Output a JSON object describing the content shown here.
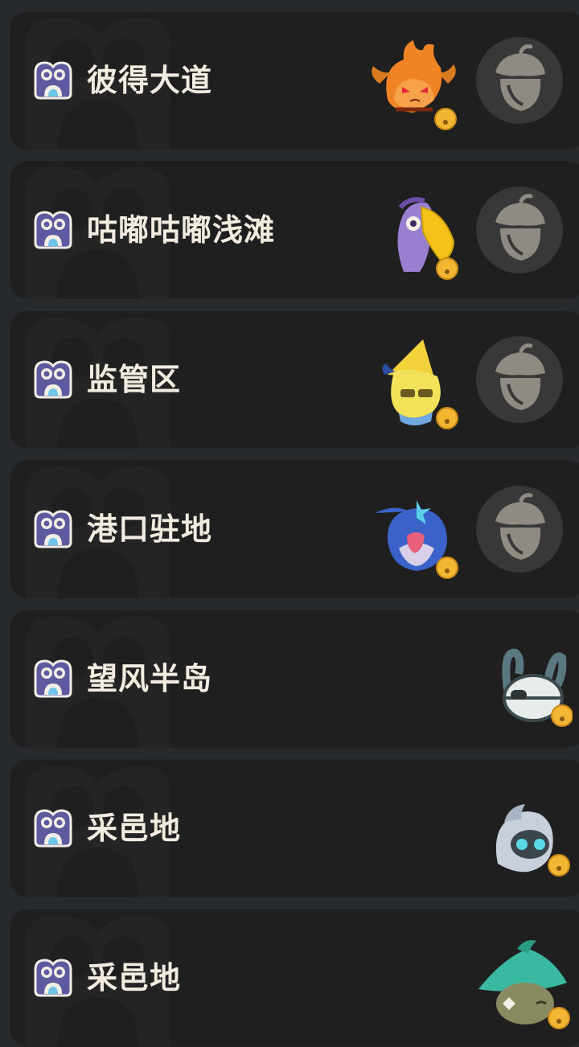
{
  "locations": [
    {
      "name": "彼得大道",
      "has_acorn": true
    },
    {
      "name": "咕嘟咕嘟浅滩",
      "has_acorn": true
    },
    {
      "name": "监管区",
      "has_acorn": true
    },
    {
      "name": "港口驻地",
      "has_acorn": true
    },
    {
      "name": "望风半岛",
      "has_acorn": false
    },
    {
      "name": "采邑地",
      "has_acorn": false
    },
    {
      "name": "采邑地",
      "has_acorn": false
    }
  ],
  "icons": {
    "location": "owl-location-icon",
    "pets": [
      "fire-pet-icon",
      "purple-bird-pet-icon",
      "yellow-horn-pet-icon",
      "blue-bird-pet-icon",
      "white-robot-pet-icon",
      "ghost-robot-pet-icon",
      "green-leaf-pet-icon"
    ],
    "collect": "acorn-icon",
    "bell": "bell-icon"
  },
  "colors": {
    "background": "#262a2c",
    "card": "#1f1f20",
    "text": "#f2ece0",
    "owl_icon": "#5d5aa0",
    "bell": "#f2b632",
    "acorn_button": "#383838",
    "acorn": "#8f8b82"
  }
}
